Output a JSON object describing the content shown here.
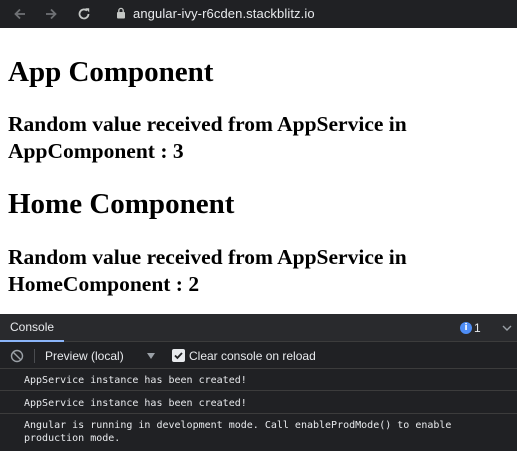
{
  "browser": {
    "url": "angular-ivy-r6cden.stackblitz.io",
    "icons": [
      "back-arrow-icon",
      "forward-arrow-icon",
      "reload-icon",
      "lock-icon"
    ]
  },
  "page": {
    "app_heading": "App Component",
    "app_text": "Random value received from AppService in AppComponent : 3",
    "home_heading": "Home Component",
    "home_text": "Random value received from AppService in HomeComponent : 2"
  },
  "devtools": {
    "tab_console": "Console",
    "issues_count": "1",
    "context_label": "Preview (local)",
    "clear_on_reload_label": "Clear console on reload",
    "clear_on_reload_checked": true,
    "logs": [
      "AppService instance has been created!",
      "AppService instance has been created!",
      "Angular is running in development mode. Call enableProdMode() to enable production mode."
    ],
    "colors": {
      "accent": "#8ab4f8",
      "issue": "#4e8df5",
      "bg": "#202124"
    }
  }
}
